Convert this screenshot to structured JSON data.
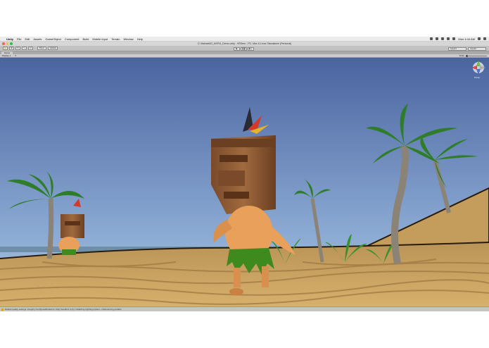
{
  "menubar": {
    "app_name": "Unity",
    "items": [
      "File",
      "Edit",
      "Assets",
      "GameObject",
      "Component",
      "Build",
      "Mobile Input",
      "Terrain",
      "Window",
      "Help"
    ],
    "clock": "Mon 4:44 AM"
  },
  "window": {
    "title": "Ⓒ Maleast4D_MVRU_Demo.unity - VRDem - PC, Mac & Linux Standalone (Personal)"
  },
  "toolbar": {
    "pivot_label": "Pivot",
    "global_label": "Global",
    "layers_label": "Layers",
    "layout_label": "Layout"
  },
  "game_view": {
    "tab_label": "Game",
    "display_label": "Display 1",
    "scale_label": "Scale",
    "gizmo_label": "Persp"
  },
  "status": {
    "message": "Default quality settings: Integrity ConfiguredDefault to Unity Sandbox 4 (A): Initializing Lighting system + Referencing prefabs"
  },
  "colors": {
    "sky_top": "#4f6aa3",
    "sky_bottom": "#a9c2dc",
    "sand": "#c9a060",
    "mask_wood": "#8b5a35",
    "skin": "#e8a05a",
    "grass_skirt": "#3e8a1e",
    "palm_leaf": "#2f7d2a"
  }
}
